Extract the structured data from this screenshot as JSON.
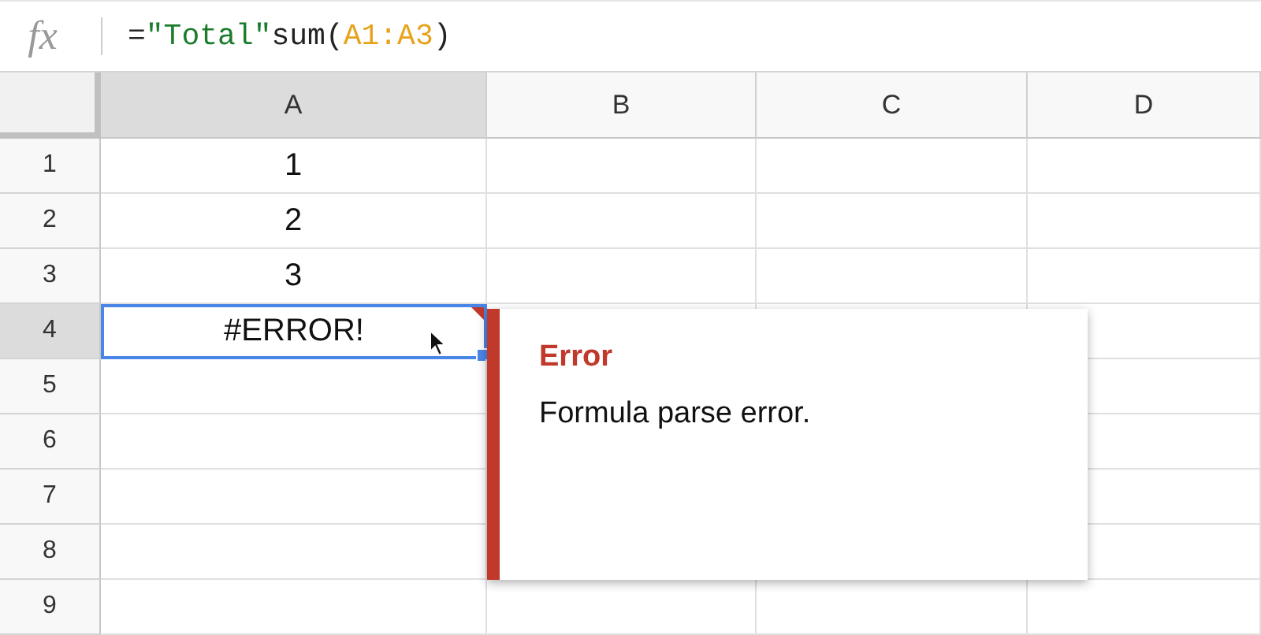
{
  "formula_bar": {
    "label": "fx",
    "formula": [
      {
        "kind": "plain",
        "text": "="
      },
      {
        "kind": "string",
        "text": "\"Total\""
      },
      {
        "kind": "plain",
        "text": "sum("
      },
      {
        "kind": "range",
        "text": "A1:A3"
      },
      {
        "kind": "plain",
        "text": ")"
      }
    ]
  },
  "sheet": {
    "columns": [
      {
        "label": "A",
        "selected": true
      },
      {
        "label": "B",
        "selected": false
      },
      {
        "label": "C",
        "selected": false
      },
      {
        "label": "D",
        "selected": false
      }
    ],
    "rows": [
      {
        "label": "1",
        "selected": false,
        "cells": [
          "1",
          "",
          "",
          ""
        ]
      },
      {
        "label": "2",
        "selected": false,
        "cells": [
          "2",
          "",
          "",
          ""
        ]
      },
      {
        "label": "3",
        "selected": false,
        "cells": [
          "3",
          "",
          "",
          ""
        ]
      },
      {
        "label": "4",
        "selected": true,
        "error": true,
        "cells": [
          "#ERROR!",
          "",
          "",
          ""
        ]
      },
      {
        "label": "5",
        "selected": false,
        "cells": [
          "",
          "",
          "",
          ""
        ]
      },
      {
        "label": "6",
        "selected": false,
        "cells": [
          "",
          "",
          "",
          ""
        ]
      },
      {
        "label": "7",
        "selected": false,
        "cells": [
          "",
          "",
          "",
          ""
        ]
      },
      {
        "label": "8",
        "selected": false,
        "cells": [
          "",
          "",
          "",
          ""
        ]
      },
      {
        "label": "9",
        "selected": false,
        "cells": [
          "",
          "",
          "",
          ""
        ]
      }
    ]
  },
  "error_popup": {
    "title": "Error",
    "message": "Formula parse error."
  }
}
